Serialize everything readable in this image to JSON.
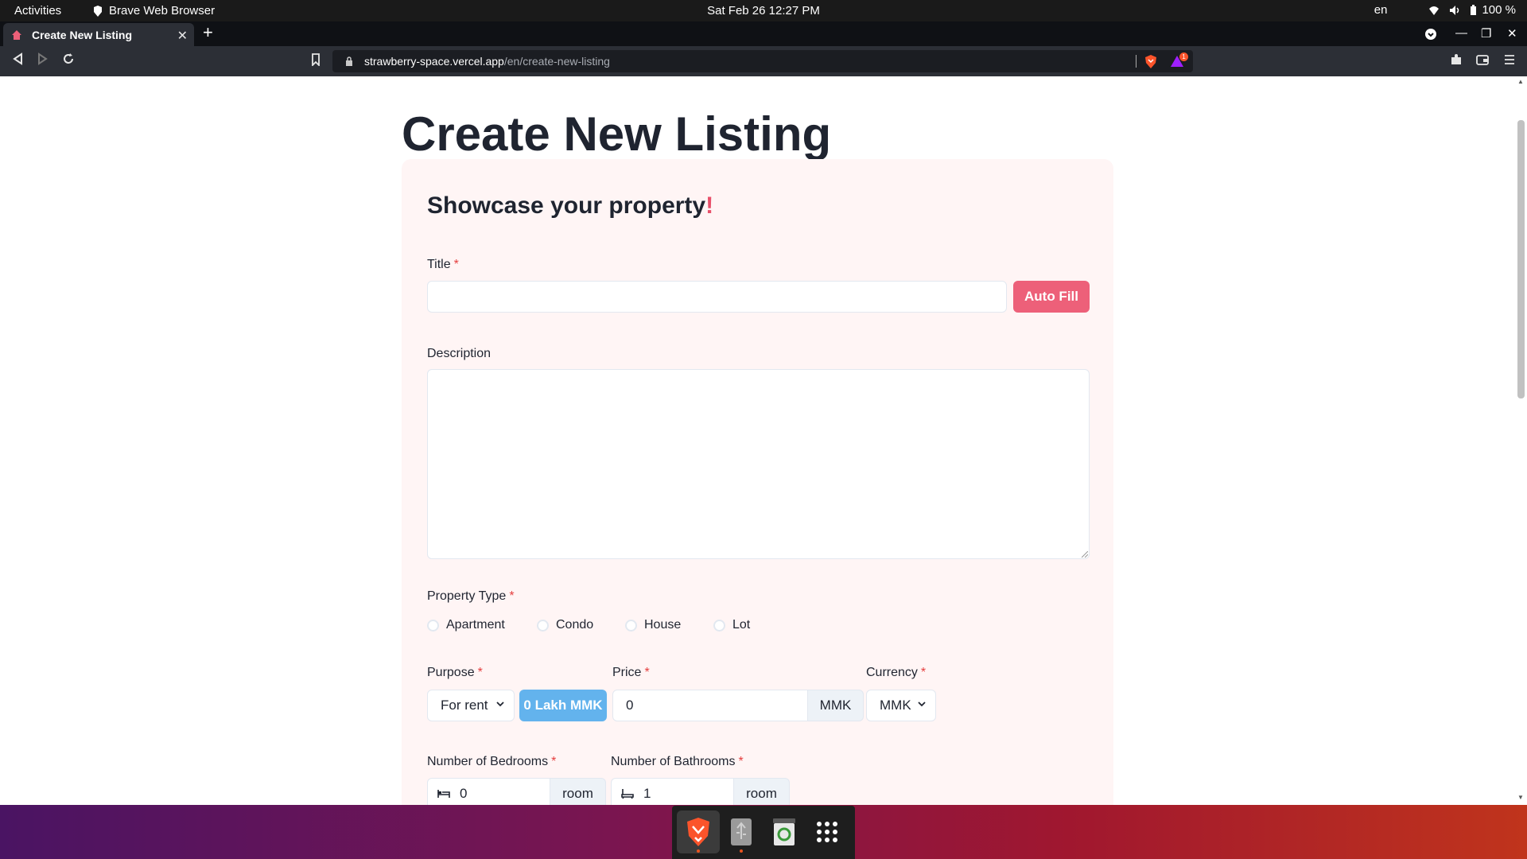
{
  "topbar": {
    "activities": "Activities",
    "app_name": "Brave Web Browser",
    "clock": "Sat Feb 26  12:27 PM",
    "lang": "en",
    "battery": "100 %"
  },
  "browser": {
    "tab_title": "Create New Listing",
    "url_host": "strawberry-space.vercel.app",
    "url_path": "/en/create-new-listing",
    "notification_count": "1"
  },
  "page": {
    "title": "Create New Listing",
    "card_heading": "Showcase your property",
    "card_heading_accent": "!",
    "required_mark": "*",
    "title_label": "Title",
    "title_value": "",
    "autofill_button": "Auto Fill",
    "description_label": "Description",
    "description_value": "",
    "property_type_label": "Property Type",
    "property_types": [
      {
        "label": "Apartment"
      },
      {
        "label": "Condo"
      },
      {
        "label": "House"
      },
      {
        "label": "Lot"
      }
    ],
    "purpose_label": "Purpose",
    "purpose_value": "For rent",
    "price_badge": "0 Lakh MMK",
    "price_label": "Price",
    "price_value": "0",
    "price_unit": "MMK",
    "currency_label": "Currency",
    "currency_value": "MMK",
    "bedrooms_label": "Number of Bedrooms",
    "bedrooms_value": "0",
    "bedrooms_unit": "room",
    "bathrooms_label": "Number of Bathrooms",
    "bathrooms_value": "1",
    "bathrooms_unit": "room"
  },
  "dock": {
    "items": [
      {
        "icon": "brave-browser-icon",
        "active": true
      },
      {
        "icon": "usb-drive-icon",
        "active": false
      },
      {
        "icon": "trash-icon",
        "active": false
      },
      {
        "icon": "app-grid-icon",
        "active": false
      }
    ]
  },
  "colors": {
    "accent_pink": "#ed6079",
    "badge_blue": "#63b3ed",
    "card_bg": "#fff5f5",
    "required_red": "#e53e3e"
  }
}
